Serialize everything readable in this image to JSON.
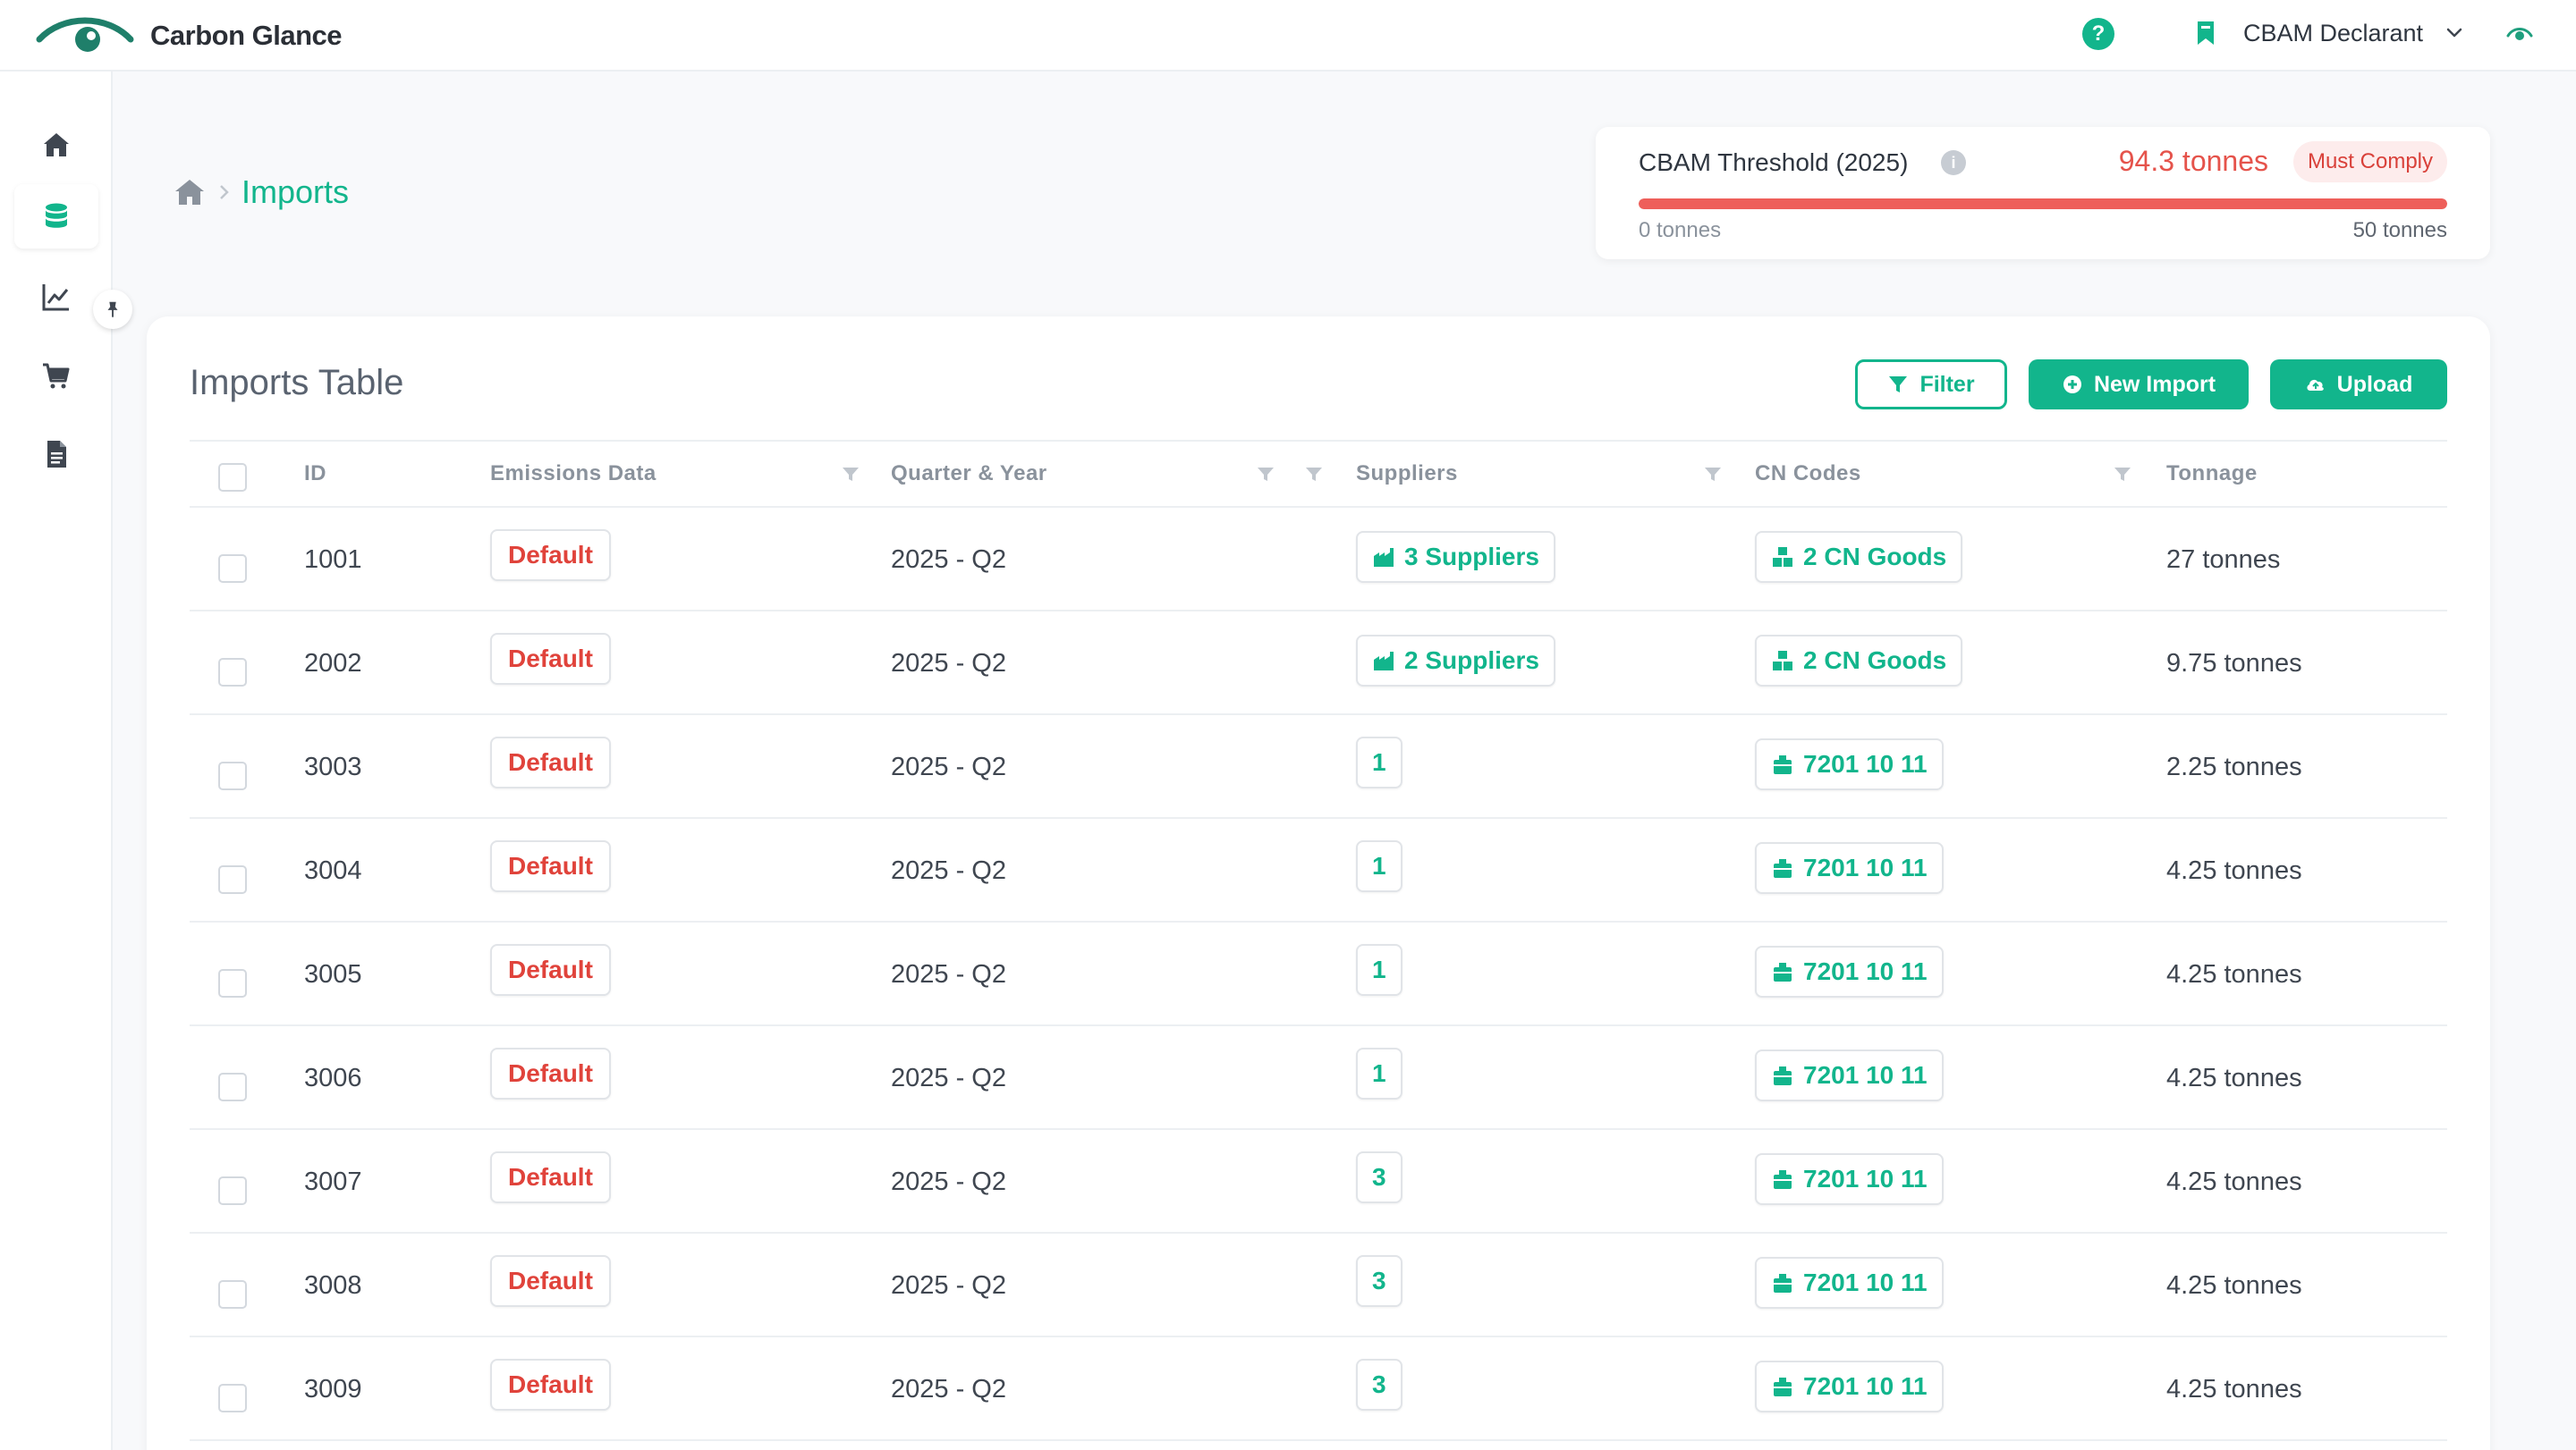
{
  "app": {
    "brand": "Carbon Glance",
    "role": "CBAM Declarant",
    "accent": "#12b58c",
    "danger": "#e5534b"
  },
  "header_icons": [
    "eye-logo-icon",
    "help-icon",
    "bookmark-icon",
    "chevron-down-icon",
    "eye-icon"
  ],
  "sidebar": {
    "items": [
      {
        "icon": "home-icon",
        "active": false
      },
      {
        "icon": "database-icon",
        "active": true
      },
      {
        "icon": "chart-line-icon",
        "active": false
      },
      {
        "icon": "cart-icon",
        "active": false
      },
      {
        "icon": "document-icon",
        "active": false
      }
    ],
    "pin_icon": "pin-icon"
  },
  "breadcrumb": {
    "home_icon": "home-icon",
    "current": "Imports"
  },
  "threshold": {
    "title": "CBAM Threshold (2025)",
    "value": "94.3 tonnes",
    "badge": "Must Comply",
    "min_label": "0 tonnes",
    "max_label": "50 tonnes",
    "progress_fraction": 1.0
  },
  "table": {
    "title": "Imports Table",
    "buttons": {
      "filter": "Filter",
      "new_import": "New Import",
      "upload": "Upload"
    },
    "columns": {
      "id": "ID",
      "emissions": "Emissions Data",
      "quarter": "Quarter & Year",
      "suppliers": "Suppliers",
      "cn_codes": "CN Codes",
      "tonnage": "Tonnage"
    },
    "rows": [
      {
        "id": "1001",
        "emissions": "Default",
        "quarter": "2025 - Q2",
        "suppliers": "3 Suppliers",
        "suppliers_type": "group",
        "cn": "2 CN Goods",
        "cn_type": "group",
        "tonnage": "27 tonnes"
      },
      {
        "id": "2002",
        "emissions": "Default",
        "quarter": "2025 - Q2",
        "suppliers": "2 Suppliers",
        "suppliers_type": "group",
        "cn": "2 CN Goods",
        "cn_type": "group",
        "tonnage": "9.75 tonnes"
      },
      {
        "id": "3003",
        "emissions": "Default",
        "quarter": "2025 - Q2",
        "suppliers": "1",
        "suppliers_type": "single",
        "cn": "7201 10 11",
        "cn_type": "single",
        "tonnage": "2.25 tonnes"
      },
      {
        "id": "3004",
        "emissions": "Default",
        "quarter": "2025 - Q2",
        "suppliers": "1",
        "suppliers_type": "single",
        "cn": "7201 10 11",
        "cn_type": "single",
        "tonnage": "4.25 tonnes"
      },
      {
        "id": "3005",
        "emissions": "Default",
        "quarter": "2025 - Q2",
        "suppliers": "1",
        "suppliers_type": "single",
        "cn": "7201 10 11",
        "cn_type": "single",
        "tonnage": "4.25 tonnes"
      },
      {
        "id": "3006",
        "emissions": "Default",
        "quarter": "2025 - Q2",
        "suppliers": "1",
        "suppliers_type": "single",
        "cn": "7201 10 11",
        "cn_type": "single",
        "tonnage": "4.25 tonnes"
      },
      {
        "id": "3007",
        "emissions": "Default",
        "quarter": "2025 - Q2",
        "suppliers": "3",
        "suppliers_type": "single",
        "cn": "7201 10 11",
        "cn_type": "single",
        "tonnage": "4.25 tonnes"
      },
      {
        "id": "3008",
        "emissions": "Default",
        "quarter": "2025 - Q2",
        "suppliers": "3",
        "suppliers_type": "single",
        "cn": "7201 10 11",
        "cn_type": "single",
        "tonnage": "4.25 tonnes"
      },
      {
        "id": "3009",
        "emissions": "Default",
        "quarter": "2025 - Q2",
        "suppliers": "3",
        "suppliers_type": "single",
        "cn": "7201 10 11",
        "cn_type": "single",
        "tonnage": "4.25 tonnes"
      }
    ]
  }
}
